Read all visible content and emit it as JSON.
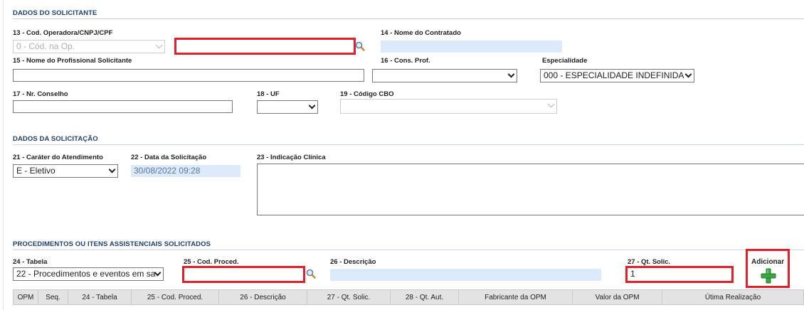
{
  "section_solicitante": {
    "title": "DADOS DO SOLICITANTE",
    "cod_operadora_label": "13 - Cod. Operadora/CNPJ/CPF",
    "cod_operadora_select": "0 - Cód. na Op.",
    "nome_contratado_label": "14 - Nome do Contratado",
    "nome_contratado_value": "",
    "nome_profissional_label": "15 - Nome do Profissional Solicitante",
    "cons_prof_label": "16 - Cons. Prof.",
    "especialidade_label": "Especialidade",
    "especialidade_select": "000 - ESPECIALIDADE INDEFINIDA",
    "nr_conselho_label": "17 - Nr. Conselho",
    "uf_label": "18 - UF",
    "cbo_label": "19 - Código CBO"
  },
  "section_solicitacao": {
    "title": "DADOS DA SOLICITAÇÃO",
    "carater_label": "21 - Caráter do Atendimento",
    "carater_select": "E - Eletivo",
    "data_label": "22 - Data da Solicitação",
    "data_value": "30/08/2022 09:28",
    "indicacao_label": "23 - Indicação Clínica"
  },
  "section_procedimentos": {
    "title": "PROCEDIMENTOS OU ITENS ASSISTENCIAIS SOLICITADOS",
    "tabela_label": "24 - Tabela",
    "tabela_select": "22 - Procedimentos e eventos em sa",
    "cod_proced_label": "25 - Cod. Proced.",
    "descricao_label": "26 - Descrição",
    "qt_solic_label": "27 - Qt. Solic.",
    "qt_solic_value": "1",
    "adicionar_label": "Adicionar",
    "table_headers": [
      "OPM",
      "Seq.",
      "24 - Tabela",
      "25 - Cod. Proced.",
      "26 - Descrição",
      "27 - Qt. Solic.",
      "28 - Qt. Aut.",
      "Fabricante da OPM",
      "Valor da OPM",
      "Útima Realização"
    ]
  },
  "colors": {
    "highlight_red": "#e0202a",
    "section_title": "#1f3f70",
    "readonly_bg": "#ddeafb",
    "add_green": "#3aa641"
  },
  "icons": [
    "search-icon",
    "add-plus-icon",
    "chevron-down-icon"
  ]
}
